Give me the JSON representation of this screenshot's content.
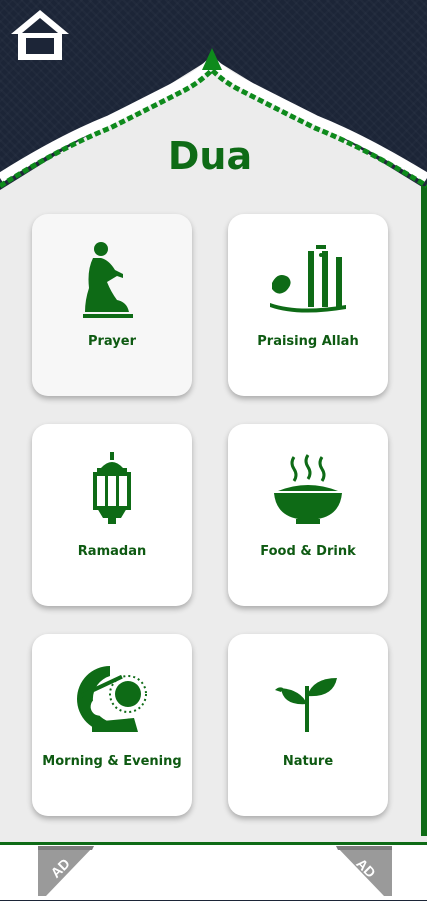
{
  "header": {
    "title": "Dua",
    "home_icon": "home-icon"
  },
  "categories": [
    {
      "label": "Prayer",
      "icon": "praying-person-icon"
    },
    {
      "label": "Praising Allah",
      "icon": "allah-calligraphy-icon"
    },
    {
      "label": "Ramadan",
      "icon": "lantern-icon"
    },
    {
      "label": "Food & Drink",
      "icon": "food-bowl-icon"
    },
    {
      "label": "Morning & Evening",
      "icon": "sun-moon-icon"
    },
    {
      "label": "Nature",
      "icon": "plant-icon"
    }
  ],
  "ads": {
    "left_label": "AD",
    "right_label": "AD"
  },
  "colors": {
    "primary_green": "#0e6b16",
    "background_navy": "#1c2537",
    "panel": "#ececec"
  }
}
